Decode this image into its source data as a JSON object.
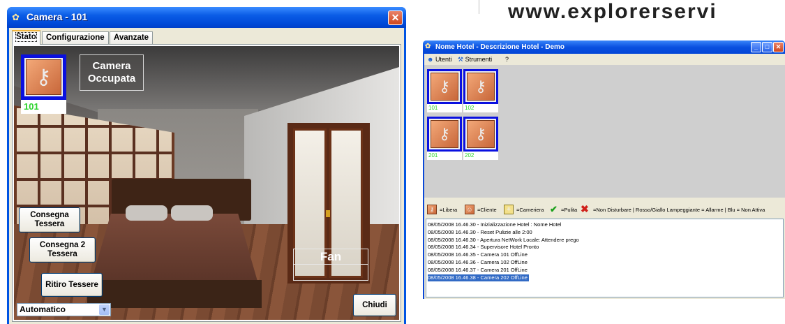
{
  "camera_window": {
    "title": "Camera - 101",
    "close_glyph": "✕",
    "tabs": [
      {
        "label": "Stato",
        "active": true
      },
      {
        "label": "Configurazione",
        "active": false
      },
      {
        "label": "Avanzate",
        "active": false
      }
    ],
    "room_number": "101",
    "room_icon": "key-icon",
    "status_line1": "Camera",
    "status_line2": "Occupata",
    "buttons": {
      "consegna_tessera": "Consegna Tessera",
      "consegna_2_tessera": "Consegna 2 Tessera",
      "ritiro_tessere": "Ritiro Tessere",
      "chiudi": "Chiudi"
    },
    "fan_label": "Fan",
    "fan_value": "",
    "mode_select": "Automatico"
  },
  "logo": {
    "text": "www.explorerservi"
  },
  "hotel_window": {
    "title": "Nome Hotel - Descrizione Hotel - Demo",
    "menu": [
      {
        "label": "Utenti",
        "icon": "users-icon"
      },
      {
        "label": "Strumenti",
        "icon": "tools-icon"
      },
      {
        "label": "?",
        "icon": ""
      }
    ],
    "rooms": [
      {
        "number": "101"
      },
      {
        "number": "102"
      },
      {
        "number": "201"
      },
      {
        "number": "202"
      }
    ],
    "legend": {
      "libera": "=Libera",
      "cliente": "=Cliente",
      "cameriera": "=Cameriera",
      "pulita": "=Pulita",
      "non_disturbare": "=Non Disturbare | Rosso/Giallo Lampeggiante = Allarme | Blu = Non Attiva"
    },
    "log": [
      "08/05/2008 16.46.30 - Inizializzazione Hotel : Nome Hotel",
      "08/05/2008 16.46.30 - Reset Pulizie alle 2:00",
      "08/05/2008 16.46.30 - Apertura NetWork Locale: Attendere prego",
      "08/05/2008 16.46.34 - Supervisore Hotel Pronto",
      "08/05/2008 16.46.35 - Camera 101 OffLine",
      "08/05/2008 16.46.36 - Camera 102 OffLine",
      "08/05/2008 16.46.37 - Camera 201 OffLine",
      "08/05/2008 16.46.38 - Camera 202 OffLine"
    ],
    "colors": {
      "selection": "#316ac5",
      "room_border": "#0a10e0",
      "room_number": "#2bd32b"
    }
  }
}
